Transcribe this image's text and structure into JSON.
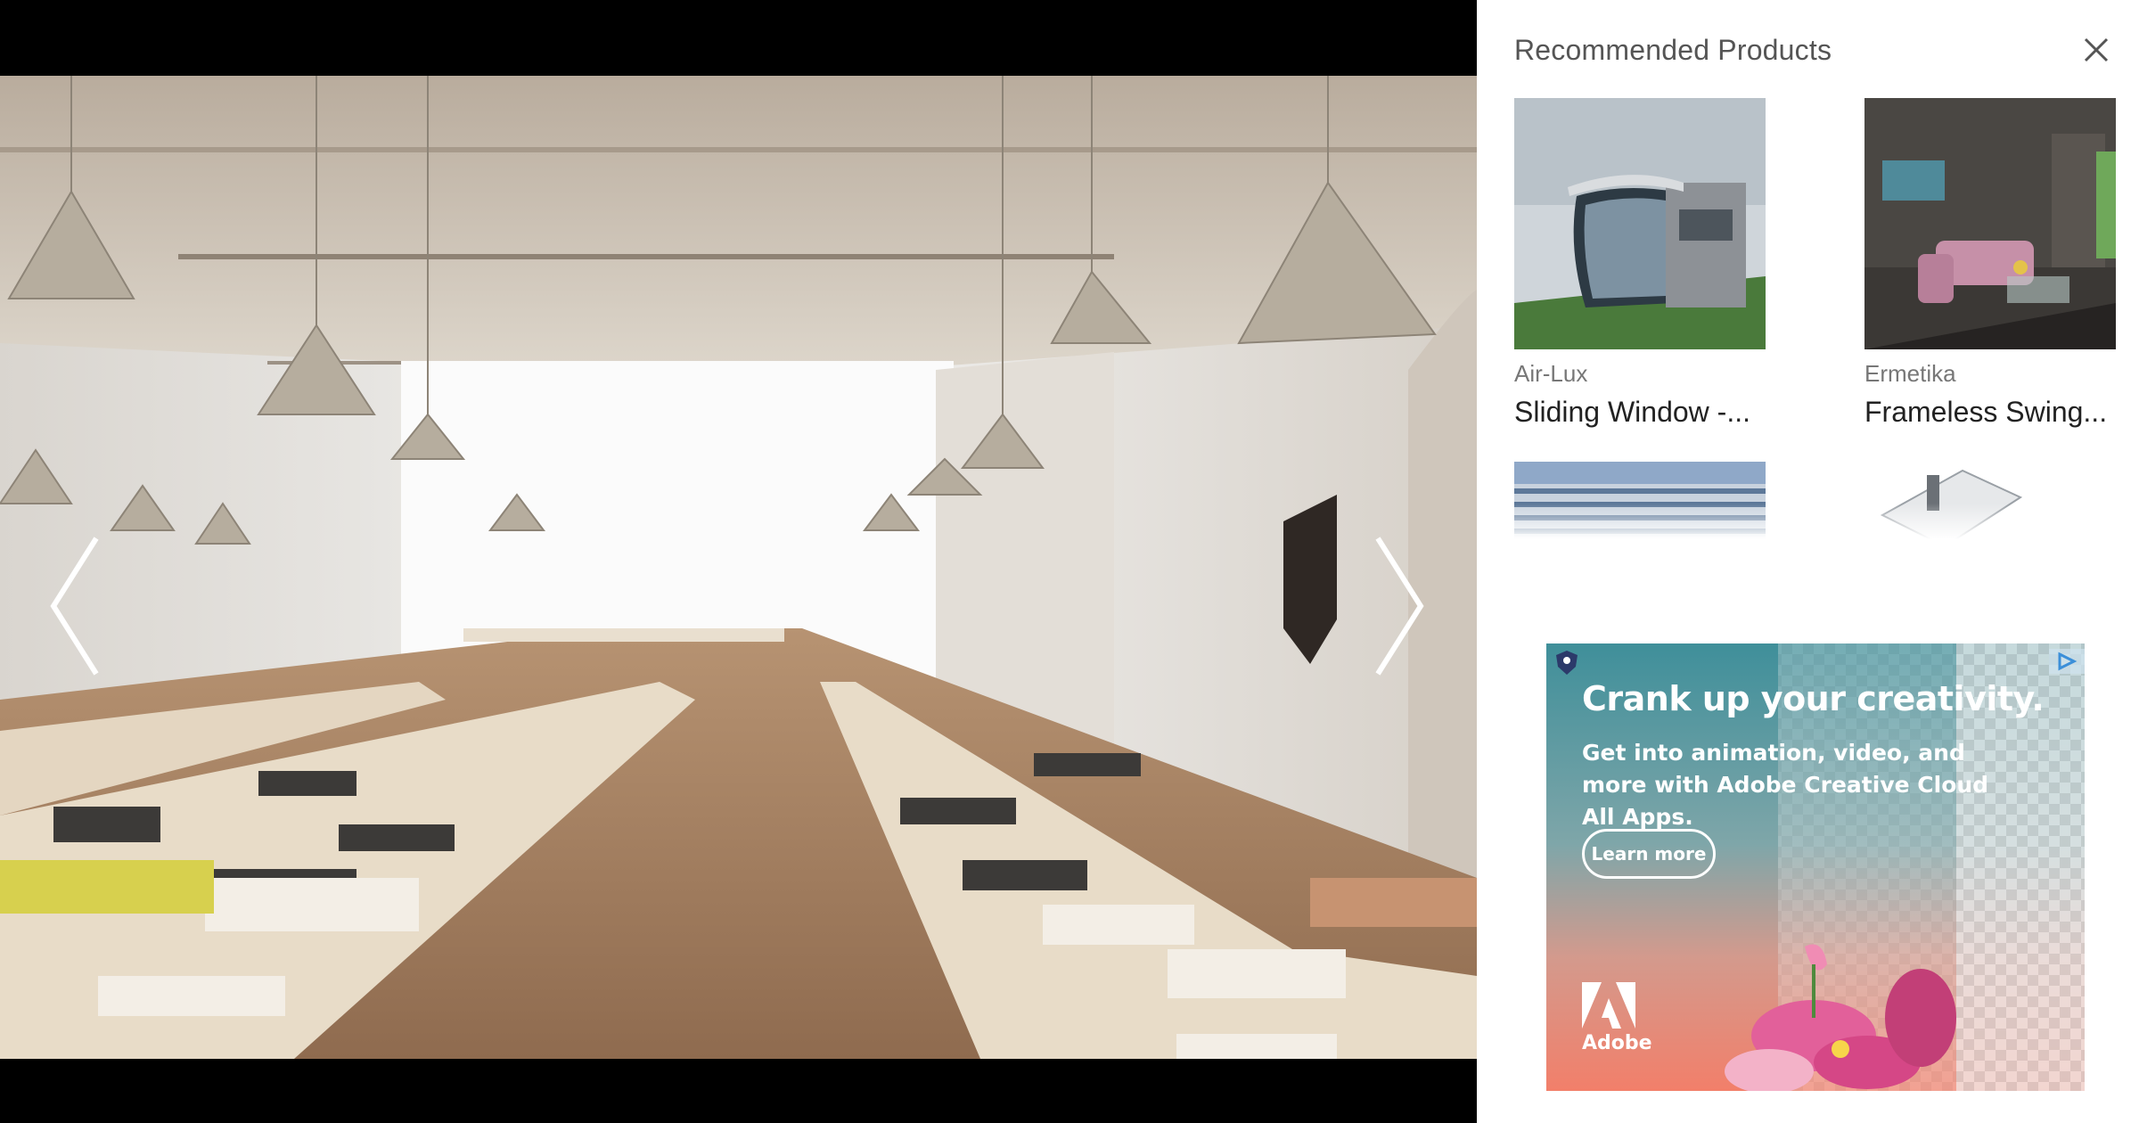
{
  "gallery": {
    "photo_subject": "bookstore interior with long tables of books and pyramid pendant lamps",
    "prev_icon": "chevron-left-icon",
    "next_icon": "chevron-right-icon"
  },
  "panel": {
    "title": "Recommended Products",
    "close_icon": "close-icon",
    "products": [
      {
        "brand": "Air-Lux",
        "name": "Sliding Window -...",
        "thumb": "curved glass modern house"
      },
      {
        "brand": "Ermetika",
        "name": "Frameless Swing...",
        "thumb": "living room with pink sofa"
      },
      {
        "brand": "",
        "name": "",
        "thumb": "office building facade"
      },
      {
        "brand": "",
        "name": "",
        "thumb": "white window frame profile"
      }
    ]
  },
  "ad": {
    "headline": "Crank up your creativity.",
    "body": "Get into animation, video, and more with Adobe Creative Cloud All Apps.",
    "cta": "Learn more",
    "logo_text": "Adobe",
    "colors": {
      "top": "#3f8f9a",
      "bottom": "#f27f6a",
      "brand": "#ff0000"
    }
  }
}
